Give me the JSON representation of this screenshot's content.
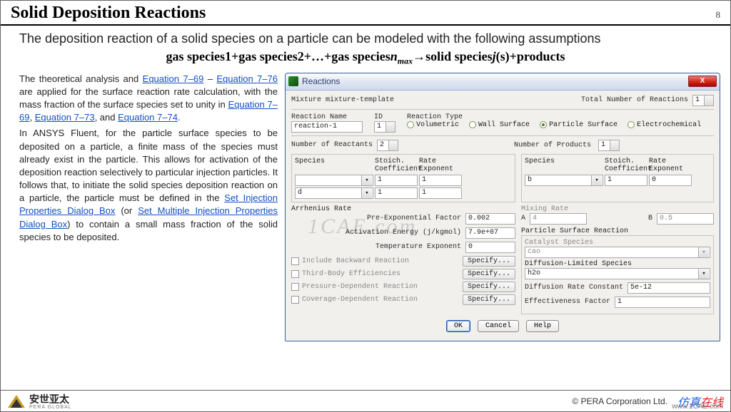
{
  "header": {
    "title": "Solid Deposition Reactions",
    "page": "8"
  },
  "intro": "The deposition reaction of a solid species on a particle can be modeled with the following assumptions",
  "equation": {
    "lhs1": "gas species1+gas species2+…+gas species",
    "nmax1": "n",
    "nmax2": "max",
    "arrow": "→",
    "rhs1": "solid species",
    "j": "j",
    "rhs2": "(s)+products"
  },
  "para1a": "The theoretical analysis and ",
  "link_eq69": "Equation 7–69",
  "para1b": " – ",
  "link_eq76": "Equation 7–76",
  "para1c": " are applied for the surface reaction rate calculation, with the mass fraction of the surface species set to unity in ",
  "link_eq69b": "Equation 7–69",
  "para1d": ", ",
  "link_eq73": "Equation 7–73",
  "para1e": ", and ",
  "link_eq74": "Equation 7–74",
  "para1f": ".",
  "para2a": "In ANSYS Fluent, for the particle surface species to be deposited on a particle, a finite mass of the species must already exist in the particle. This allows for activation of the deposition reaction selectively to particular injection particles. It follows that, to initiate the solid species deposition reaction on a particle, the particle must be defined in the ",
  "link_inj1": "Set Injection Properties Dialog Box",
  "para2b": " (or ",
  "link_inj2": "Set Multiple Injection Properties Dialog Box",
  "para2c": ") to contain a small mass fraction of the solid species to be deposited.",
  "dlg": {
    "title": "Reactions",
    "close": "X",
    "mixture_lab": "Mixture",
    "mixture_val": "mixture-template",
    "total_lab": "Total Number of Reactions",
    "total_val": "1",
    "rxname_lab": "Reaction Name",
    "rxname_val": "reaction-1",
    "id_lab": "ID",
    "id_val": "1",
    "rtype_lab": "Reaction Type",
    "rtype": {
      "vol": "Volumetric",
      "wall": "Wall Surface",
      "part": "Particle Surface",
      "elec": "Electrochemical"
    },
    "nreact_lab": "Number of Reactants",
    "nreact_val": "2",
    "nprod_lab": "Number of Products",
    "nprod_val": "1",
    "hdr": {
      "species": "Species",
      "stoich": "Stoich.\nCoefficient",
      "rate": "Rate\nExponent"
    },
    "reac": [
      {
        "sp": "",
        "st": "1",
        "re": "1"
      },
      {
        "sp": "d",
        "st": "1",
        "re": "1"
      }
    ],
    "prod": [
      {
        "sp": "b",
        "st": "1",
        "re": "0"
      }
    ],
    "arr": {
      "title": "Arrhenius Rate",
      "pre_lab": "Pre-Exponential Factor",
      "pre_val": "0.002",
      "act_lab": "Activation Energy (j/kgmol)",
      "act_val": "7.9e+07",
      "temp_lab": "Temperature Exponent",
      "temp_val": "0",
      "chk1": "Include Backward Reaction",
      "chk2": "Third-Body Efficiencies",
      "chk3": "Pressure-Dependent Reaction",
      "chk4": "Coverage-Dependent Reaction",
      "btn": "Specify..."
    },
    "mix": {
      "title": "Mixing Rate",
      "a_lab": "A",
      "a_val": "4",
      "b_lab": "B",
      "b_val": "0.5"
    },
    "psr": {
      "title": "Particle Surface Reaction",
      "cat_lab": "Catalyst Species",
      "cat_val": "cao",
      "dls_lab": "Diffusion-Limited Species",
      "dls_val": "h2o",
      "drc_lab": "Diffusion Rate Constant",
      "drc_val": "5e-12",
      "eff_lab": "Effectiveness Factor",
      "eff_val": "1"
    },
    "btns": {
      "ok": "OK",
      "cancel": "Cancel",
      "help": "Help"
    }
  },
  "footer": {
    "brand_cn": "安世亚太",
    "brand_en": "PERA GLOBAL",
    "copyright": "©   PERA Corporation Ltd.",
    "site1": "仿真",
    "site2": "在线",
    "url": "www.1CAE.com"
  },
  "watermark": "1CAE.com"
}
